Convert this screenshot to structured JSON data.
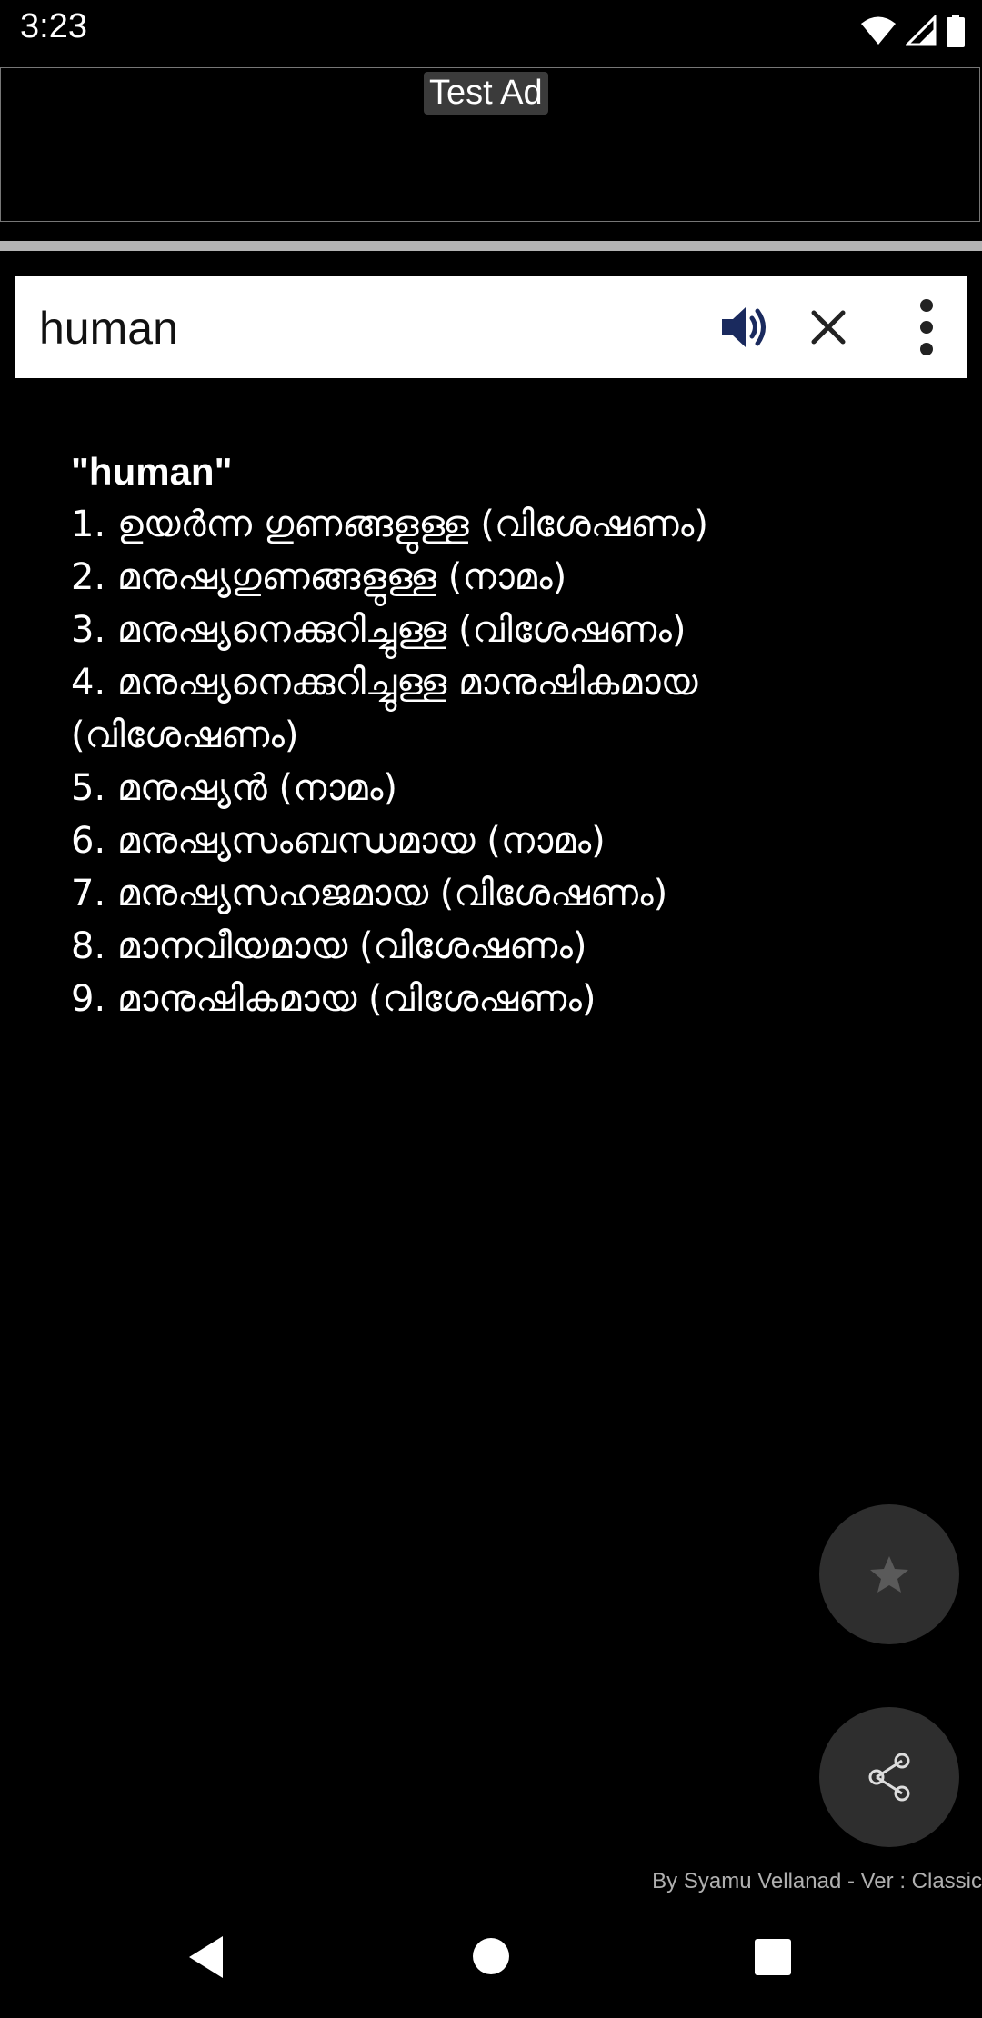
{
  "status_bar": {
    "time": "3:23",
    "icons": [
      "wifi-icon",
      "signal-icon",
      "battery-icon"
    ]
  },
  "ad": {
    "label": "Test Ad"
  },
  "search": {
    "query": "human",
    "icons": [
      "speaker-icon",
      "close-icon",
      "more-vert-icon"
    ]
  },
  "results": {
    "title": "\"human\"",
    "items": [
      "1.  ഉയർന്ന ഗുണങ്ങളുള്ള (വിശേഷണം)",
      "2.  മനുഷ്യഗുണങ്ങളുള്ള (നാമം)",
      "3.  മനുഷ്യനെക്കുറിച്ചുള്ള (വിശേഷണം)",
      "4.  മനുഷ്യനെക്കുറിച്ചുള്ള മാനുഷികമായ (വിശേഷണം)",
      "5.  മനുഷ്യൻ (നാമം)",
      "6.  മനുഷ്യസംബന്ധമായ (നാമം)",
      "7.  മനുഷ്യസഹജമായ (വിശേഷണം)",
      "8.  മാനവീയമായ (വിശേഷണം)",
      "9.  മാനുഷികമായ (വിശേഷണം)"
    ]
  },
  "fabs": {
    "star_icon": "star-icon",
    "share_icon": "share-icon"
  },
  "footer": {
    "credit": "By Syamu Vellanad - Ver : Classic"
  },
  "nav": {
    "icons": [
      "back-icon",
      "home-icon",
      "recents-icon"
    ]
  },
  "colors": {
    "background": "#000000",
    "search_bg": "#ffffff",
    "speaker": "#1a2a5e",
    "fab_bg": "#2e2e2e"
  }
}
